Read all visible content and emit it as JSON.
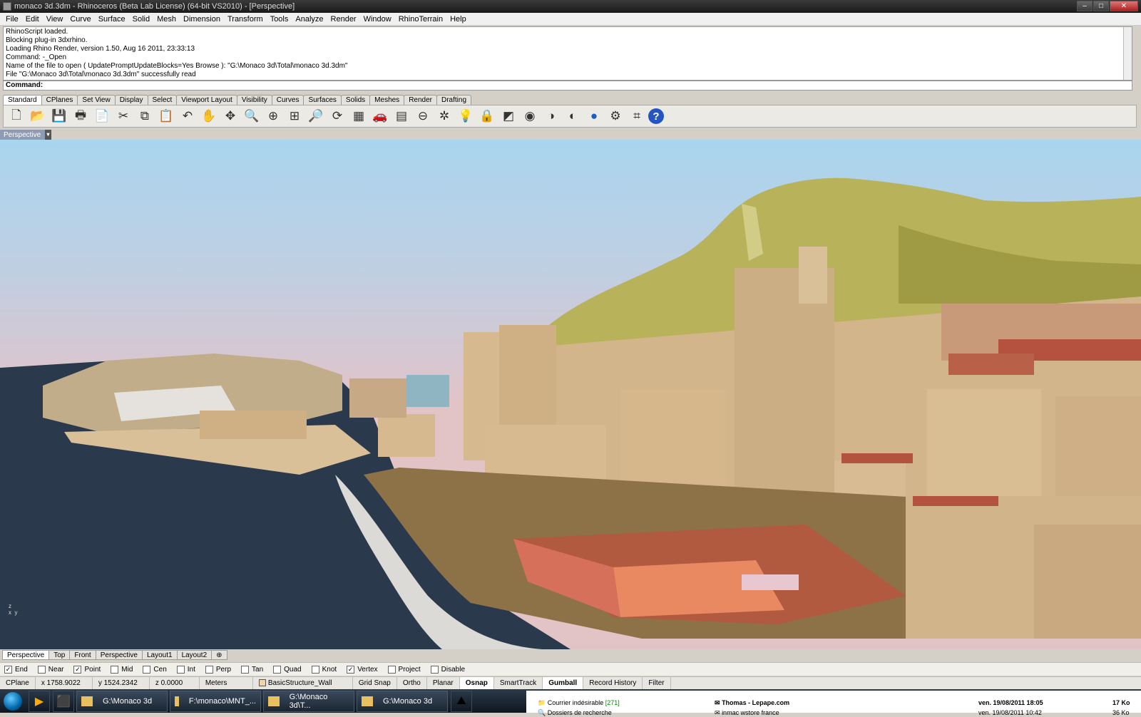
{
  "window": {
    "title": "monaco 3d.3dm - Rhinoceros (Beta Lab License) (64-bit VS2010) - [Perspective]"
  },
  "menu": [
    "File",
    "Edit",
    "View",
    "Curve",
    "Surface",
    "Solid",
    "Mesh",
    "Dimension",
    "Transform",
    "Tools",
    "Analyze",
    "Render",
    "Window",
    "RhinoTerrain",
    "Help"
  ],
  "command_history": [
    "RhinoScript loaded.",
    "Blocking plug-in 3dxrhino.",
    "Loading Rhino Render, version 1.50, Aug 16 2011, 23:33:13",
    "Command: -_Open",
    "Name of the file to open ( UpdatePromptUpdateBlocks=Yes  Browse ): \"G:\\Monaco  3d\\Total\\monaco 3d.3dm\"",
    "File \"G:\\Monaco  3d\\Total\\monaco 3d.3dm\" successfully read"
  ],
  "command_prompt": "Command:",
  "toolbar_tabs": [
    "Standard",
    "CPlanes",
    "Set View",
    "Display",
    "Select",
    "Viewport Layout",
    "Visibility",
    "Curves",
    "Surfaces",
    "Solids",
    "Meshes",
    "Render",
    "Drafting"
  ],
  "toolbar_icons": [
    "new-icon",
    "open-icon",
    "save-icon",
    "print-icon",
    "template-icon",
    "cut-icon",
    "copy-icon",
    "paste-icon",
    "undo-icon",
    "pan-icon",
    "rotate-view-icon",
    "zoom-icon",
    "zoom-window-icon",
    "zoom-extents-icon",
    "zoom-selected-icon",
    "rotate-icon",
    "four-viewports-icon",
    "car-icon",
    "grid-icon",
    "cplane-icon",
    "osnap-icon",
    "light-icon",
    "lock-icon",
    "layer-icon",
    "color-wheel-icon",
    "shaded-sphere-icon",
    "rendered-sphere-icon",
    "render-icon",
    "options-icon",
    "properties-icon",
    "help-icon"
  ],
  "viewport": {
    "label": "Perspective"
  },
  "viewport_tabs": [
    "Perspective",
    "Top",
    "Front",
    "Perspective",
    "Layout1",
    "Layout2"
  ],
  "osnaps": [
    {
      "label": "End",
      "checked": true
    },
    {
      "label": "Near",
      "checked": false
    },
    {
      "label": "Point",
      "checked": true
    },
    {
      "label": "Mid",
      "checked": false
    },
    {
      "label": "Cen",
      "checked": false
    },
    {
      "label": "Int",
      "checked": false
    },
    {
      "label": "Perp",
      "checked": false
    },
    {
      "label": "Tan",
      "checked": false
    },
    {
      "label": "Quad",
      "checked": false
    },
    {
      "label": "Knot",
      "checked": false
    },
    {
      "label": "Vertex",
      "checked": true
    },
    {
      "label": "Project",
      "checked": false
    },
    {
      "label": "Disable",
      "checked": false
    }
  ],
  "status": {
    "cplane": "CPlane",
    "x": "x 1758.9022",
    "y": "y 1524.2342",
    "z": "z 0.0000",
    "units": "Meters",
    "layer": "BasicStructure_Wall",
    "toggles": [
      "Grid Snap",
      "Ortho",
      "Planar",
      "Osnap",
      "SmartTrack",
      "Gumball",
      "Record History",
      "Filter"
    ],
    "active_toggles": [
      "Osnap",
      "Gumball"
    ]
  },
  "taskbar": {
    "windows": [
      "G:\\Monaco 3d",
      "F:\\monaco\\MNT_...",
      "G:\\Monaco 3d\\T...",
      "G:\\Monaco 3d"
    ]
  },
  "mail": {
    "folders": [
      {
        "label": "Courrier indésirable",
        "count": "[271]"
      },
      {
        "label": "Dossiers de recherche",
        "count": ""
      }
    ],
    "items": [
      {
        "from": "Thomas - Lepape.com",
        "date": "ven. 19/08/2011 18:05",
        "size": "17 Ko"
      },
      {
        "from": "inmac wstore france",
        "date": "ven. 19/08/2011 10:42",
        "size": "36 Ko"
      }
    ]
  },
  "colors": {
    "accent": "#8e9bb3",
    "sea": "#2a3a4c",
    "building": "#d8bd95",
    "roof": "#c25a48",
    "hill": "#b8b25a"
  }
}
